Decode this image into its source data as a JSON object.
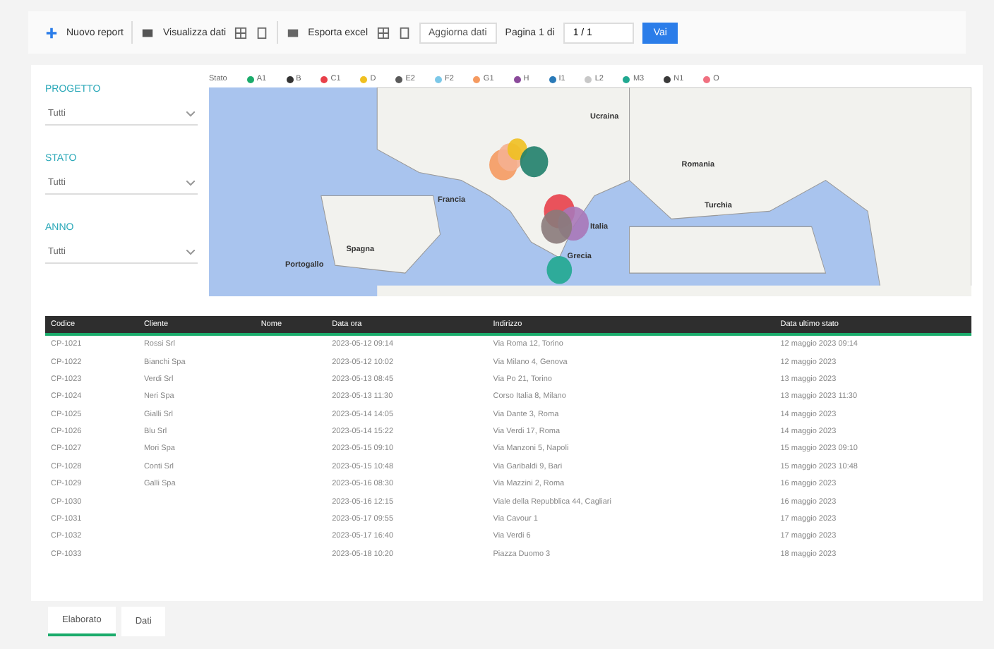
{
  "toolbar": {
    "new_label": "Nuovo report",
    "view_label": "Visualizza dati",
    "export_label": "Esporta excel",
    "refresh_button": "Aggiorna dati",
    "page_label": "Pagina 1 di",
    "page_field": "1 / 1",
    "go_button": "Vai"
  },
  "slicers": [
    {
      "title": "PROGETTO",
      "value": "Tutti"
    },
    {
      "title": "STATO",
      "value": "Tutti"
    },
    {
      "title": "ANNO",
      "value": "Tutti"
    }
  ],
  "map": {
    "legend_title": "Stato",
    "legend": [
      {
        "label": "A1",
        "color": "#1aab6b"
      },
      {
        "label": "B",
        "color": "#333333"
      },
      {
        "label": "C1",
        "color": "#e8404a"
      },
      {
        "label": "D",
        "color": "#f0c020"
      },
      {
        "label": "E2",
        "color": "#5a5a5a"
      },
      {
        "label": "F2",
        "color": "#7cc8e8"
      },
      {
        "label": "G1",
        "color": "#f59a60"
      },
      {
        "label": "H",
        "color": "#8a4a9a"
      },
      {
        "label": "I1",
        "color": "#2a7ab8"
      },
      {
        "label": "L2",
        "color": "#c8c8c8"
      },
      {
        "label": "M3",
        "color": "#20a890"
      },
      {
        "label": "N1",
        "color": "#3a3a3a"
      },
      {
        "label": "O",
        "color": "#f07080"
      }
    ],
    "labels": [
      "Ucraina",
      "Romania",
      "Francia",
      "Turchia",
      "Italia",
      "Spagna",
      "Grecia",
      "Portogallo"
    ]
  },
  "table": {
    "columns": [
      "Codice",
      "Cliente",
      "Nome",
      "Data ora",
      "Indirizzo",
      "Data ultimo stato"
    ],
    "rows": [
      [
        "CP-1021",
        "Rossi Srl",
        "",
        "2023-05-12 09:14",
        "Via Roma 12, Torino",
        "12 maggio 2023 09:14"
      ],
      [
        "CP-1022",
        "Bianchi Spa",
        "",
        "2023-05-12 10:02",
        "Via Milano 4, Genova",
        "12 maggio 2023"
      ],
      [
        "CP-1023",
        "Verdi Srl",
        "",
        "2023-05-13 08:45",
        "Via Po 21, Torino",
        "13 maggio 2023"
      ],
      [
        "CP-1024",
        "Neri Spa",
        "",
        "2023-05-13 11:30",
        "Corso Italia 8, Milano",
        "13 maggio 2023 11:30"
      ],
      [
        "CP-1025",
        "Gialli Srl",
        "",
        "2023-05-14 14:05",
        "Via Dante 3, Roma",
        "14 maggio 2023"
      ],
      [
        "CP-1026",
        "Blu Srl",
        "",
        "2023-05-14 15:22",
        "Via Verdi 17, Roma",
        "14 maggio 2023"
      ],
      [
        "CP-1027",
        "Mori Spa",
        "",
        "2023-05-15 09:10",
        "Via Manzoni 5, Napoli",
        "15 maggio 2023 09:10"
      ],
      [
        "CP-1028",
        "Conti Srl",
        "",
        "2023-05-15 10:48",
        "Via Garibaldi 9, Bari",
        "15 maggio 2023 10:48"
      ],
      [
        "CP-1029",
        "Galli Spa",
        "",
        "2023-05-16 08:30",
        "Via Mazzini 2, Roma",
        "16 maggio 2023"
      ],
      [
        "CP-1030",
        "",
        "",
        "2023-05-16 12:15",
        "Viale della Repubblica 44, Cagliari",
        "16 maggio 2023"
      ],
      [
        "CP-1031",
        "",
        "",
        "2023-05-17 09:55",
        "Via Cavour 1",
        "17 maggio 2023"
      ],
      [
        "CP-1032",
        "",
        "",
        "2023-05-17 16:40",
        "Via Verdi 6",
        "17 maggio 2023"
      ],
      [
        "CP-1033",
        "",
        "",
        "2023-05-18 10:20",
        "Piazza Duomo 3",
        "18 maggio 2023"
      ]
    ]
  },
  "page_tabs": [
    {
      "label": "Elaborato",
      "selected": true
    },
    {
      "label": "Dati",
      "selected": false
    }
  ]
}
